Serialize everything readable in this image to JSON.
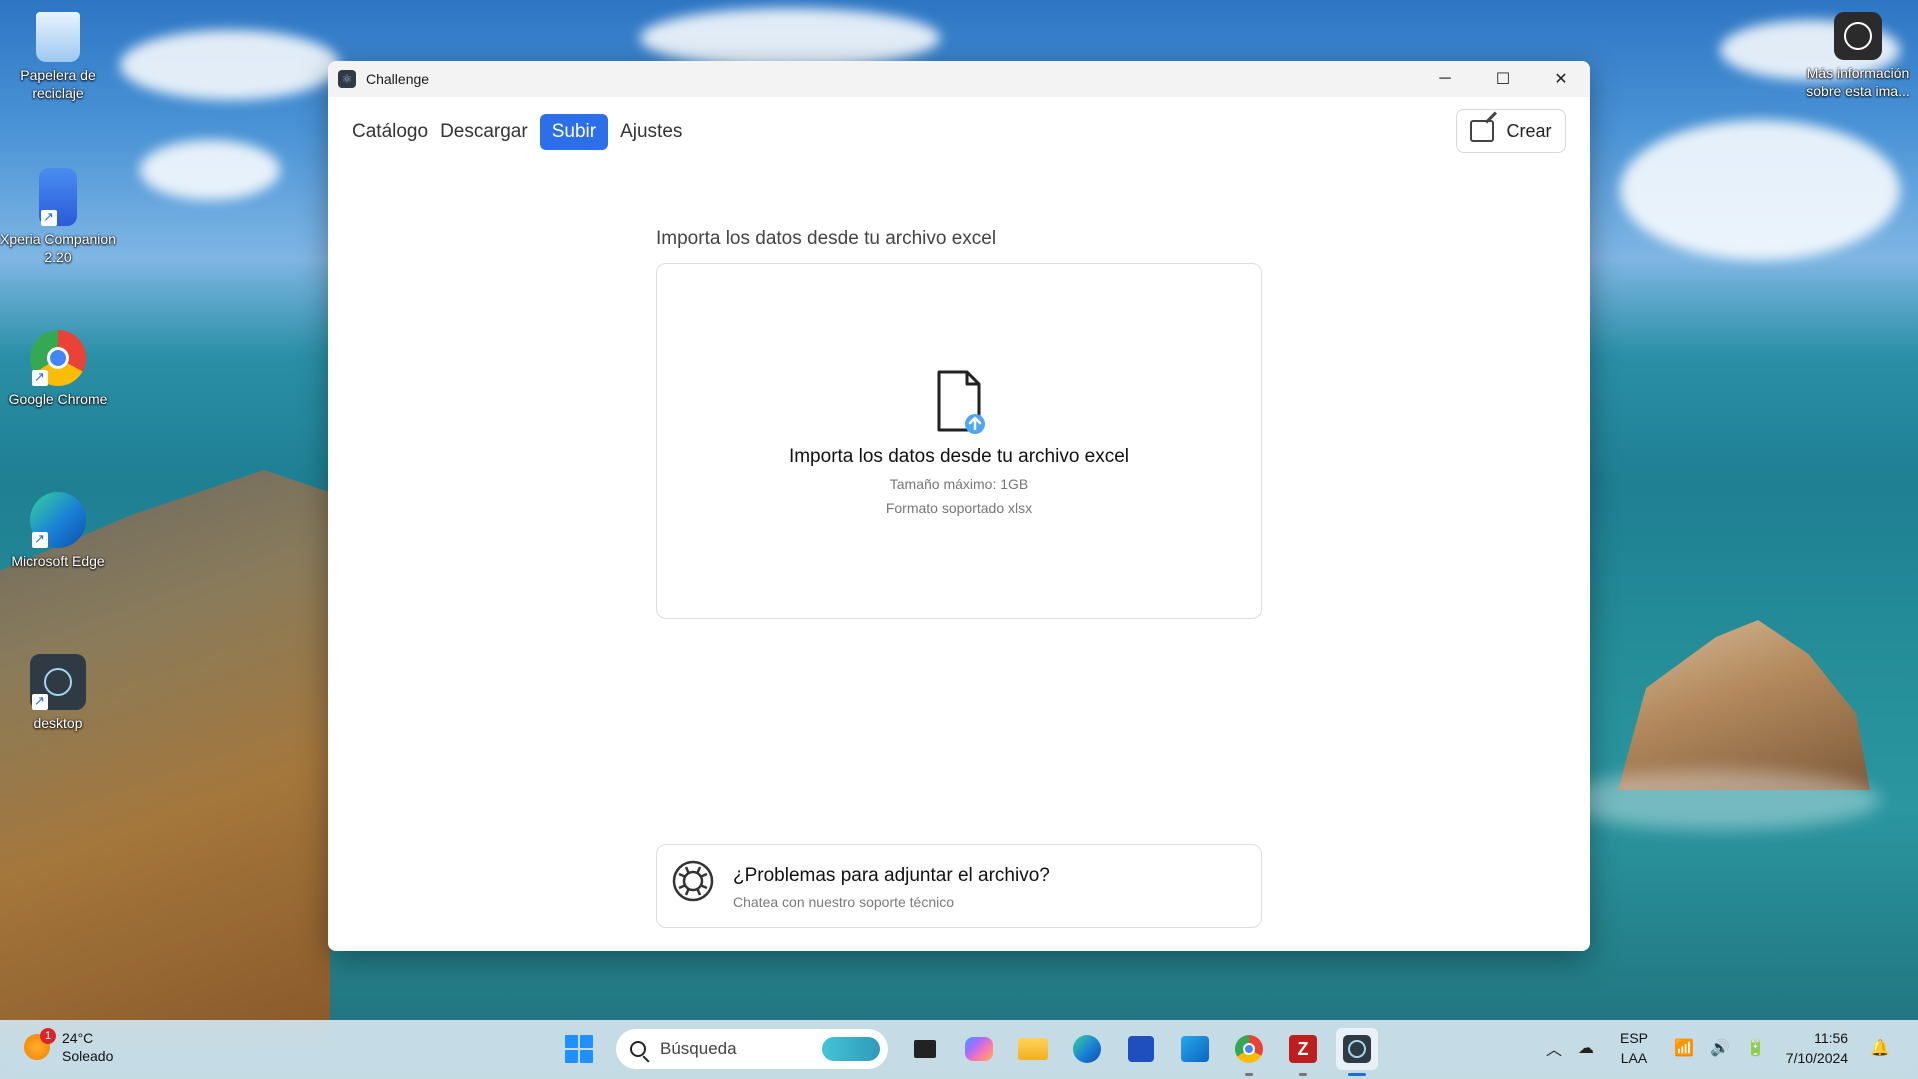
{
  "desktop": {
    "icons": [
      {
        "label": "Papelera de reciclaje"
      },
      {
        "label": "Xperia Companion 2.20"
      },
      {
        "label": "Google Chrome"
      },
      {
        "label": "Microsoft Edge"
      },
      {
        "label": "desktop"
      }
    ],
    "info_label": "Más información sobre esta ima..."
  },
  "window": {
    "title": "Challenge",
    "controls": {
      "minimize": "─",
      "maximize": "☐",
      "close": "✕"
    }
  },
  "nav": {
    "items": [
      {
        "label": "Catálogo"
      },
      {
        "label": "Descargar"
      },
      {
        "label": "Subir",
        "active": true
      },
      {
        "label": "Ajustes"
      }
    ],
    "create_label": "Crear"
  },
  "upload": {
    "heading": "Importa los datos desde tu archivo excel",
    "dropzone_title": "Importa los datos desde tu archivo excel",
    "max_size": "Tamaño máximo: 1GB",
    "format": "Formato soportado xlsx"
  },
  "help": {
    "title": "¿Problemas para adjuntar el archivo?",
    "subtitle": "Chatea con nuestro soporte técnico"
  },
  "taskbar": {
    "weather": {
      "temp": "24°C",
      "condition": "Soleado",
      "badge": "1"
    },
    "search_placeholder": "Búsqueda",
    "language": {
      "line1": "ESP",
      "line2": "LAA"
    },
    "clock": {
      "time": "11:56",
      "date": "7/10/2024"
    }
  },
  "colors": {
    "accent": "#2c6fe8",
    "upload_badge": "#4ea6f5"
  }
}
